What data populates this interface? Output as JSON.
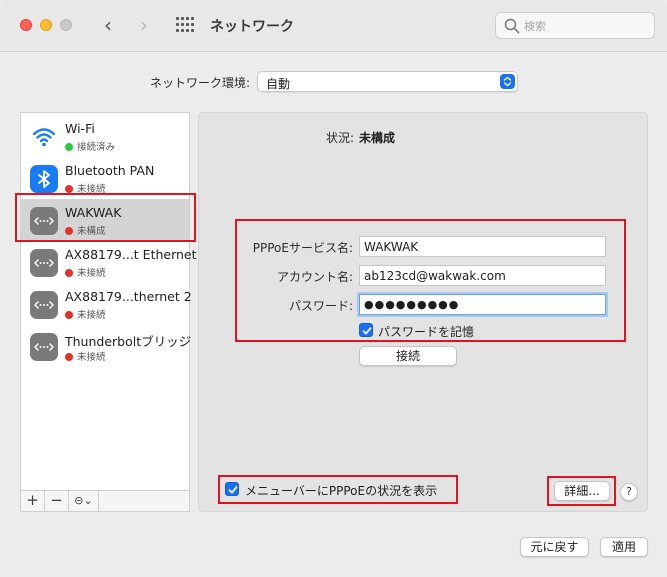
{
  "window": {
    "title": "ネットワーク",
    "search_placeholder": "検索"
  },
  "location": {
    "label": "ネットワーク環境:",
    "value": "自動"
  },
  "services": [
    {
      "name": "Wi-Fi",
      "status": "接続済み",
      "status_color": "#28c840",
      "icon": "wifi-icon",
      "selected": false
    },
    {
      "name": "Bluetooth PAN",
      "status": "未接続",
      "status_color": "#e5302a",
      "icon": "bluetooth-icon",
      "selected": false
    },
    {
      "name": "WAKWAK",
      "status": "未構成",
      "status_color": "#e5302a",
      "icon": "ethernet-icon",
      "selected": true
    },
    {
      "name": "AX88179...t Ethernet",
      "status": "未接続",
      "status_color": "#e5302a",
      "icon": "ethernet-icon",
      "selected": false
    },
    {
      "name": "AX88179...thernet 2",
      "status": "未接続",
      "status_color": "#e5302a",
      "icon": "ethernet-icon",
      "selected": false
    },
    {
      "name": "Thunderboltブリッジ",
      "status": "未接続",
      "status_color": "#e5302a",
      "icon": "ethernet-icon",
      "selected": false
    }
  ],
  "sidebar_footer": {
    "add": "+",
    "remove": "−",
    "action": "⊝⌄"
  },
  "detail": {
    "status_label": "状況:",
    "status_value": "未構成",
    "service_name_label": "PPPoEサービス名:",
    "service_name_value": "WAKWAK",
    "account_label": "アカウント名:",
    "account_value": "ab123cd@wakwak.com",
    "password_label": "パスワード:",
    "password_value": "●●●●●●●●●",
    "remember_label": "パスワードを記憶",
    "connect_label": "接続",
    "menubar_label": "メニューバーにPPPoEの状況を表示",
    "advanced_label": "詳細...",
    "help_label": "?"
  },
  "footer": {
    "revert_label": "元に戻す",
    "apply_label": "適用"
  },
  "colors": {
    "accent": "#1a6ff2",
    "highlight": "#e0141e",
    "connected": "#28c840",
    "disconnected": "#e5302a"
  }
}
